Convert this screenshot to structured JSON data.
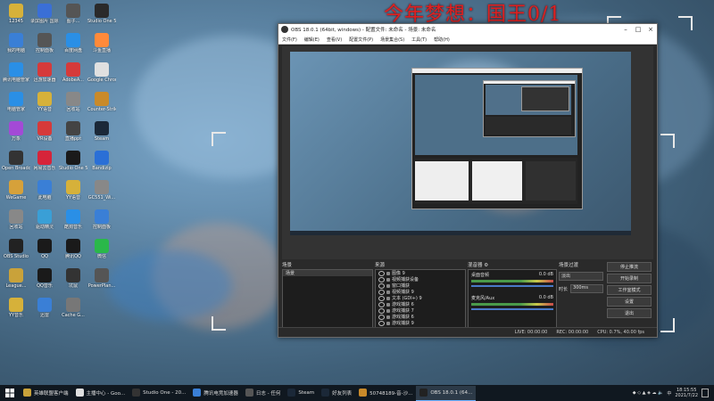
{
  "overlay": {
    "title": "今年梦想：国王0/1"
  },
  "desktop": {
    "icons": [
      {
        "label": "12345",
        "color": "#d6b13a"
      },
      {
        "label": "录屏图片 国际外",
        "color": "#3a6fd6"
      },
      {
        "label": "图子...",
        "color": "#555"
      },
      {
        "label": "Studio One 5",
        "color": "#2a2a2a"
      },
      {
        "label": "我的电脑",
        "color": "#3a7fd6"
      },
      {
        "label": "控制面板",
        "color": "#555"
      },
      {
        "label": "百度网盘",
        "color": "#2a8fe6"
      },
      {
        "label": "斗鱼直播",
        "color": "#ff8a3a"
      },
      {
        "label": "腾讯电脑管家",
        "color": "#2a8fe6"
      },
      {
        "label": "迅游加速器",
        "color": "#d63a3a"
      },
      {
        "label": "AdobeA...",
        "color": "#d63a3a"
      },
      {
        "label": "Google Chrome",
        "color": "#e0e0e0"
      },
      {
        "label": "电脑管家",
        "color": "#2a8fe6"
      },
      {
        "label": "YY语音",
        "color": "#d6b13a"
      },
      {
        "label": "回收站",
        "color": "#888"
      },
      {
        "label": "Counter-Strike",
        "color": "#c98a2a"
      },
      {
        "label": "万象",
        "color": "#a34ad6"
      },
      {
        "label": "VR设备",
        "color": "#d63a3a"
      },
      {
        "label": "直播ppt",
        "color": "#444"
      },
      {
        "label": "Steam",
        "color": "#1b2838"
      },
      {
        "label": "Open Broadcast...",
        "color": "#333"
      },
      {
        "label": "网易云音乐",
        "color": "#d6243a"
      },
      {
        "label": "Studio One 5",
        "color": "#1a1a1a"
      },
      {
        "label": "Bandizip",
        "color": "#2a6fd6"
      },
      {
        "label": "WeGame",
        "color": "#d6a13a"
      },
      {
        "label": "此电脑",
        "color": "#3a7fd6"
      },
      {
        "label": "YY语音",
        "color": "#d6b13a"
      },
      {
        "label": "GC551_Wi...",
        "color": "#888"
      },
      {
        "label": "回收站",
        "color": "#888"
      },
      {
        "label": "驱动精灵",
        "color": "#3a9fd6"
      },
      {
        "label": "酷狗音乐",
        "color": "#2a8fe6"
      },
      {
        "label": "控制面板",
        "color": "#3a7fd6"
      },
      {
        "label": "OBS Studio",
        "color": "#222"
      },
      {
        "label": "QQ",
        "color": "#1a1a1a"
      },
      {
        "label": "腾讯QQ",
        "color": "#1a1a1a"
      },
      {
        "label": "微信",
        "color": "#2ab84a"
      },
      {
        "label": "League...",
        "color": "#c9a23a"
      },
      {
        "label": "QQ音乐",
        "color": "#1a1a1a"
      },
      {
        "label": "坑鼠",
        "color": "#333"
      },
      {
        "label": "PowerPlan...",
        "color": "#555"
      },
      {
        "label": "YY音乐",
        "color": "#d6b13a"
      },
      {
        "label": "迅雷",
        "color": "#3a7fd6"
      },
      {
        "label": "Cache G...",
        "color": "#777"
      }
    ]
  },
  "obs": {
    "window_title": "OBS 18.0.1 (64bit, windows) - 配置文件: 未命名 - 场景: 未命名",
    "menu": [
      "文件(F)",
      "编辑(E)",
      "查看(V)",
      "配置文件(P)",
      "场景集合(S)",
      "工具(T)",
      "帮助(H)"
    ],
    "panels": {
      "scenes": {
        "title": "场景",
        "items": [
          "场景"
        ]
      },
      "sources": {
        "title": "来源",
        "items": [
          "图像 9",
          "视频捕获设备",
          "窗口捕获",
          "视频捕获 9",
          "文本 (GDI+) 9",
          "游戏捕获 6",
          "游戏捕获 7",
          "游戏捕获 6",
          "游戏捕获 9"
        ]
      },
      "mixer": {
        "title": "混音器",
        "channels": [
          {
            "name": "桌面音频",
            "db": "0.0 dB"
          },
          {
            "name": "麦克风/Aux",
            "db": "0.0 dB"
          }
        ]
      },
      "transitions": {
        "title": "场景过渡",
        "type": "淡出",
        "duration_label": "时长",
        "duration_value": "300ms"
      },
      "controls": [
        "停止推流",
        "开始录制",
        "工作室模式",
        "设置",
        "退出"
      ]
    },
    "status": {
      "live": "LIVE: 00:00:00",
      "rec": "REC: 00:00:00",
      "cpu": "CPU: 0.7%, 40.00 fps"
    }
  },
  "taskbar": {
    "items": [
      {
        "label": "英雄联盟客户端",
        "color": "#c9a23a"
      },
      {
        "label": "主播中心 - Goo...",
        "color": "#e0e0e0"
      },
      {
        "label": "Studio One - 20...",
        "color": "#333"
      },
      {
        "label": "腾讯电竞加速器",
        "color": "#3a7fd6"
      },
      {
        "label": "日志 - 任何",
        "color": "#555"
      },
      {
        "label": "Steam",
        "color": "#1b2838"
      },
      {
        "label": "好友列表",
        "color": "#1b2838"
      },
      {
        "label": "50748189-音-沙...",
        "color": "#c98a2a"
      },
      {
        "label": "OBS 18.0.1 (64...",
        "color": "#222",
        "active": true
      }
    ],
    "tray": {
      "time": "18:15:55",
      "date": "2021/7/22",
      "lang": "中"
    }
  }
}
